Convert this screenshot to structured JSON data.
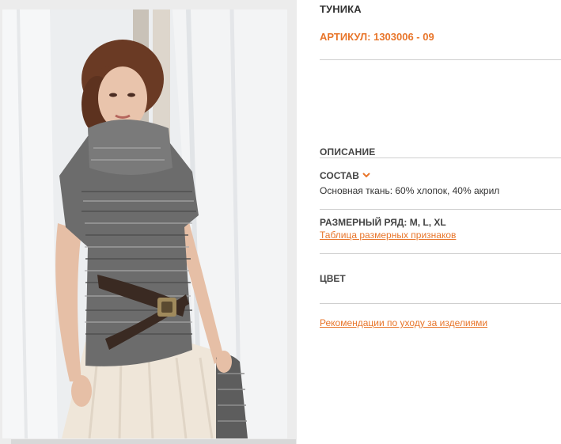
{
  "product": {
    "title": "ТУНИКА",
    "article": "АРТИКУЛ: 1303006 - 09"
  },
  "photo": {
    "alt_subject": "model-wearing-knitted-tunic"
  },
  "description": {
    "heading": "ОПИСАНИЕ",
    "composition": {
      "label": "СОСТАВ",
      "icon": "chevron-down-icon",
      "text": "Основная ткань: 60% хлопок, 40% акрил"
    },
    "sizes": {
      "label": "РАЗМЕРНЫЙ РЯД:",
      "values": "M, L, XL",
      "link": "Таблица размерных признаков"
    },
    "color": {
      "label": "ЦВЕТ"
    },
    "care_link": "Рекомендации по уходу за изделиями"
  },
  "colors": {
    "accent": "#e8752a",
    "text": "#333333",
    "divider": "#cfcfcf"
  }
}
